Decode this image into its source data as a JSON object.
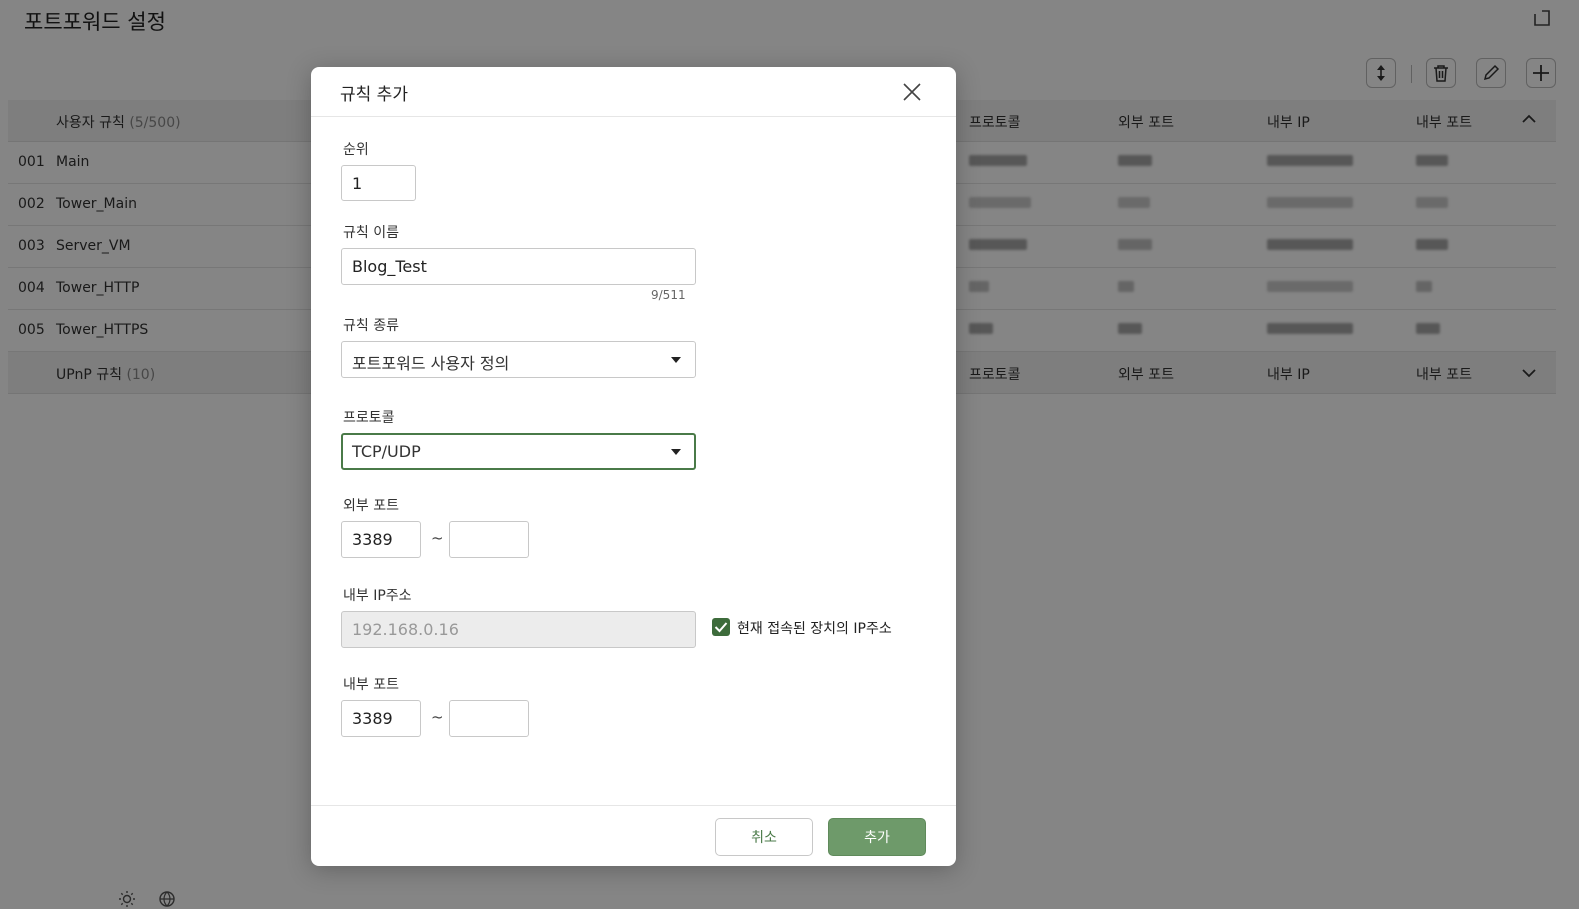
{
  "page": {
    "title": "포트포워드 설정"
  },
  "table": {
    "user_rules": {
      "label": "사용자 규칙",
      "count": "(5/500)",
      "columns": [
        "프로토콜",
        "외부 포트",
        "내부 IP",
        "내부 포트"
      ],
      "rows": [
        {
          "index": "001",
          "name": "Main"
        },
        {
          "index": "002",
          "name": "Tower_Main"
        },
        {
          "index": "003",
          "name": "Server_VM"
        },
        {
          "index": "004",
          "name": "Tower_HTTP"
        },
        {
          "index": "005",
          "name": "Tower_HTTPS"
        }
      ]
    },
    "upnp_rules": {
      "label": "UPnP 규칙",
      "count": "(10)",
      "columns": [
        "프로토콜",
        "외부 포트",
        "내부 IP",
        "내부 포트"
      ]
    }
  },
  "dialog": {
    "title": "규칙 추가",
    "priority": {
      "label": "순위",
      "value": "1"
    },
    "rule_name": {
      "label": "규칙 이름",
      "value": "Blog_Test",
      "counter": "9/511"
    },
    "rule_type": {
      "label": "규칙 종류",
      "value": "포트포워드 사용자 정의"
    },
    "protocol": {
      "label": "프로토콜",
      "value": "TCP/UDP"
    },
    "external_port": {
      "label": "외부 포트",
      "start": "3389",
      "end": "",
      "separator": "~"
    },
    "internal_ip": {
      "label": "내부 IP주소",
      "value": "192.168.0.16",
      "use_current_label": "현재 접속된 장치의 IP주소",
      "use_current_checked": true
    },
    "internal_port": {
      "label": "내부 포트",
      "start": "3389",
      "end": "",
      "separator": "~"
    },
    "buttons": {
      "cancel": "취소",
      "add": "추가"
    }
  },
  "colors": {
    "accent": "#4a7a48",
    "primary_button": "#6e9a6a",
    "overlay": "rgba(0,0,0,0.48)"
  }
}
